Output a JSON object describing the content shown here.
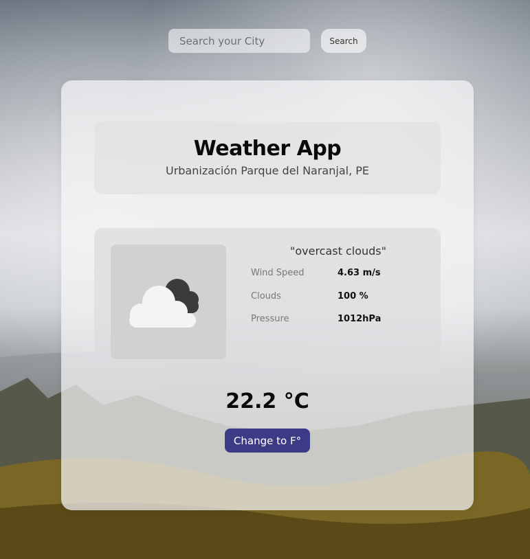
{
  "search": {
    "placeholder": "Search your City",
    "button_label": "Search"
  },
  "header": {
    "title": "Weather App",
    "location": "Urbanización Parque del Naranjal, PE"
  },
  "weather": {
    "icon": "overcast-clouds-icon",
    "description": "\"overcast clouds\"",
    "stats": [
      {
        "label": "Wind Speed",
        "value": "4.63 m/s"
      },
      {
        "label": "Clouds",
        "value": "100 %"
      },
      {
        "label": "Pressure",
        "value": "1012hPa"
      }
    ],
    "temperature": "22.2 °C"
  },
  "unit_toggle": {
    "label": "Change to F°"
  },
  "colors": {
    "button_accent": "#3d3a86",
    "card_bg": "#f5f5f7"
  }
}
